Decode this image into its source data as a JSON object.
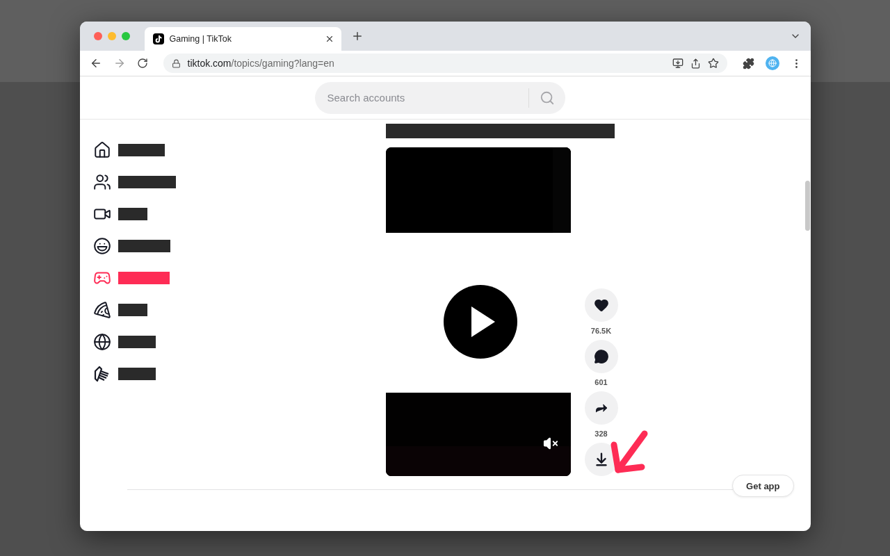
{
  "browser": {
    "tabs": [
      {
        "title": "Gaming | TikTok",
        "selected": true
      }
    ],
    "url": {
      "host": "tiktok.com",
      "path": "/topics/gaming?lang=en"
    }
  },
  "search": {
    "placeholder": "Search accounts"
  },
  "sidebar": {
    "items": [
      {
        "kind": "home",
        "selected": false
      },
      {
        "kind": "following",
        "selected": false
      },
      {
        "kind": "live",
        "selected": false
      },
      {
        "kind": "comedy",
        "selected": false
      },
      {
        "kind": "gaming",
        "selected": true
      },
      {
        "kind": "food",
        "selected": false
      },
      {
        "kind": "dance",
        "selected": false
      },
      {
        "kind": "beauty",
        "selected": false
      }
    ]
  },
  "video": {
    "muted": true,
    "actions": [
      {
        "kind": "like",
        "count": "76.5K"
      },
      {
        "kind": "comment",
        "count": "601"
      },
      {
        "kind": "share",
        "count": "328"
      },
      {
        "kind": "download"
      }
    ]
  },
  "get_app": {
    "label": "Get app"
  }
}
